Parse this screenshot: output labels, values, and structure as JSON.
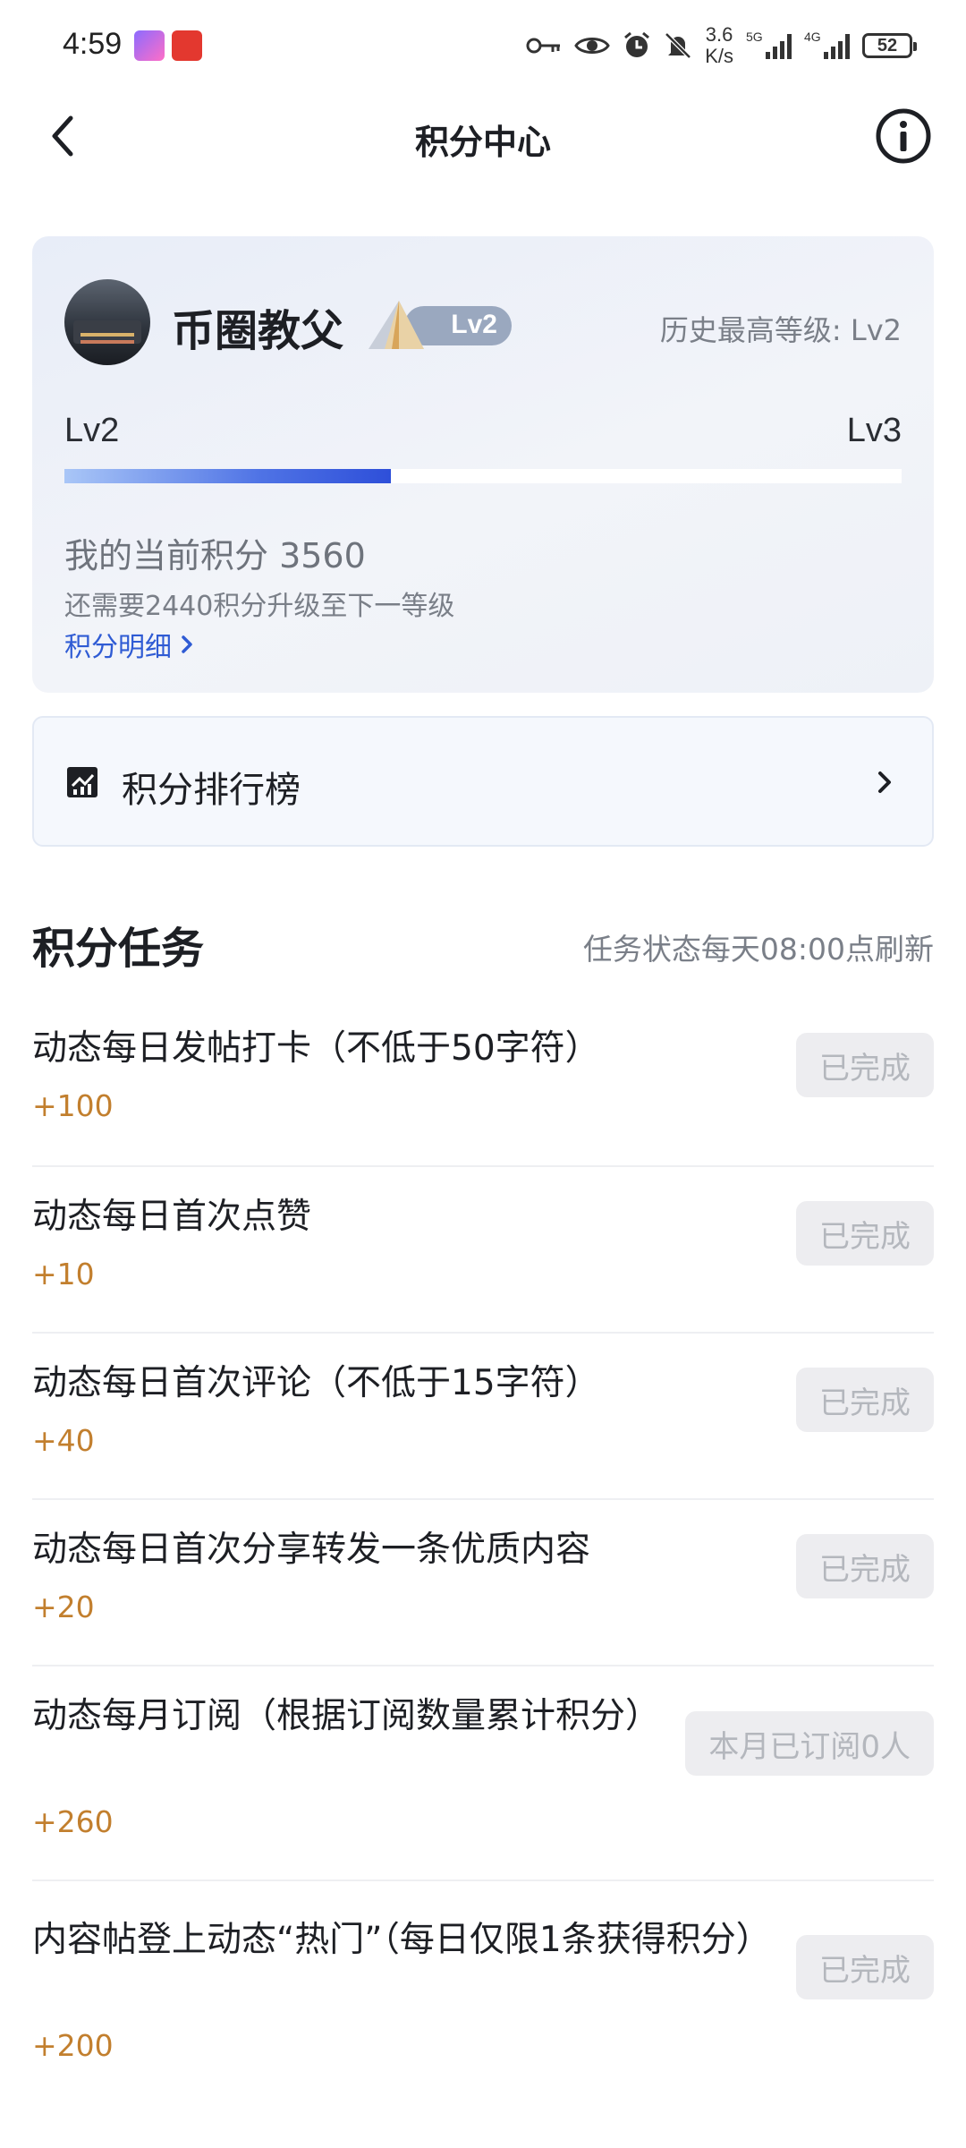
{
  "status_bar": {
    "time": "4:59",
    "speed_value": "3.6",
    "speed_unit": "K/s",
    "net1": "5G",
    "net2": "4G",
    "battery": "52"
  },
  "header": {
    "title": "积分中心"
  },
  "level_card": {
    "username": "币圈教父",
    "badge": "Lv2",
    "history_level": "历史最高等级: Lv2",
    "current_level": "Lv2",
    "next_level": "Lv3",
    "progress_fraction": 0.39,
    "current_points": "我的当前积分 3560",
    "need_points": "还需要2440积分升级至下一等级",
    "detail_link": "积分明细"
  },
  "ranking": {
    "label": "积分排行榜"
  },
  "tasks": {
    "title": "积分任务",
    "refresh_note": "任务状态每天08:00点刷新",
    "items": [
      {
        "text": "动态每日发帖打卡（不低于50字符）",
        "reward": "+100",
        "status": "已完成"
      },
      {
        "text": "动态每日首次点赞",
        "reward": "+10",
        "status": "已完成"
      },
      {
        "text": "动态每日首次评论（不低于15字符）",
        "reward": "+40",
        "status": "已完成"
      },
      {
        "text": "动态每日首次分享转发一条优质内容",
        "reward": "+20",
        "status": "已完成"
      },
      {
        "text": "动态每月订阅（根据订阅数量累计积分）",
        "reward": "+260",
        "status": "本月已订阅0人"
      },
      {
        "text": "内容帖登上动态“热门”（每日仅限1条获得积分）",
        "reward": "+200",
        "status": "已完成"
      }
    ]
  },
  "colors": {
    "accent_blue": "#2f5bd4",
    "reward_orange": "#c27f2e",
    "disabled_bg": "#ededf0",
    "disabled_text": "#b4b7bd"
  }
}
